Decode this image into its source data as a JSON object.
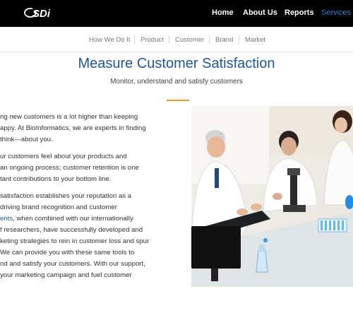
{
  "header": {
    "brand_fragment": "CS",
    "logo_label": "SDi",
    "nav": [
      {
        "label": "Home"
      },
      {
        "label": "About Us"
      },
      {
        "label": "Reports"
      },
      {
        "label": "Services"
      }
    ],
    "active_nav": "Services"
  },
  "subnav": {
    "items": [
      {
        "label": "How We Do It"
      },
      {
        "label": "Product"
      },
      {
        "label": "Customer"
      },
      {
        "label": "Brand"
      },
      {
        "label": "Market"
      }
    ]
  },
  "hero": {
    "title": "Measure Customer Satisfaction",
    "subtitle": "Monitor, understand and satisfy customers"
  },
  "body": {
    "para1": [
      "ng new customers is a lot higher than keeping",
      "appy. At BioInformatics, we are experts in finding",
      "think—about you."
    ],
    "para2": [
      "ur customers feel about your products and",
      "an ongoing process; customer retention is one",
      "tant contributions to your bottom line."
    ],
    "para3_line1": "satisfaction establishes your reputation as a",
    "para3_line2": "driving brand recognition and customer",
    "para3_line3_link": "ents",
    "para3_line3_rest": ", when combined with our internationally",
    "para3_rest": [
      "f researchers, have successfully developed and",
      "keting strategies to rein in customer loss and spur",
      "We can provide you with these same tools to",
      "nd and satisfy your customers. With our support,",
      " your marketing campaign and fuel customer"
    ]
  },
  "colors": {
    "nav_bg": "#000000",
    "nav_active": "#2a7fd4",
    "title_blue": "#1f5599",
    "accent_orange": "#f29a1e"
  }
}
